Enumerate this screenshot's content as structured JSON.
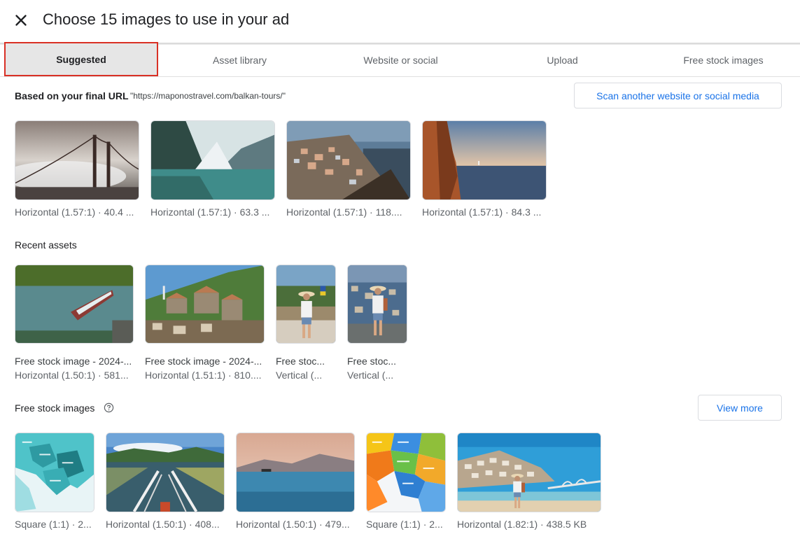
{
  "header": {
    "title": "Choose 15 images to use in your ad",
    "close_icon": "close-icon"
  },
  "tabs": [
    {
      "label": "Suggested",
      "active": true
    },
    {
      "label": "Asset library",
      "active": false
    },
    {
      "label": "Website or social",
      "active": false
    },
    {
      "label": "Upload",
      "active": false
    },
    {
      "label": "Free stock images",
      "active": false
    }
  ],
  "suggested": {
    "title": "Based on your final URL",
    "url": "\"https://maponostravel.com/balkan-tours/\"",
    "scan_button": "Scan another website or social media",
    "items": [
      {
        "caption": "Horizontal (1.57:1) · 40.4 ..."
      },
      {
        "caption": "Horizontal (1.57:1) · 63.3 ..."
      },
      {
        "caption": "Horizontal (1.57:1) · 118...."
      },
      {
        "caption": "Horizontal (1.57:1) · 84.3 ..."
      }
    ]
  },
  "recent": {
    "title": "Recent assets",
    "items": [
      {
        "name": "Free stock image - 2024-...",
        "caption": "Horizontal (1.50:1) · 581..."
      },
      {
        "name": "Free stock image - 2024-...",
        "caption": "Horizontal (1.51:1) · 810...."
      },
      {
        "name": "Free stoc...",
        "caption": "Vertical (..."
      },
      {
        "name": "Free stoc...",
        "caption": "Vertical (..."
      }
    ]
  },
  "stock": {
    "title": "Free stock images",
    "help_icon": "help-circle-icon",
    "view_more": "View more",
    "items": [
      {
        "caption": "Square (1:1) · 2..."
      },
      {
        "caption": "Horizontal (1.50:1) · 408..."
      },
      {
        "caption": "Horizontal (1.50:1) · 479..."
      },
      {
        "caption": "Square (1:1) · 2..."
      },
      {
        "caption": "Horizontal (1.82:1) · 438.5 KB"
      }
    ]
  },
  "colors": {
    "accent": "#1a73e8",
    "active_tab_border": "#d93025",
    "active_tab_bg": "#e6e6e6"
  }
}
